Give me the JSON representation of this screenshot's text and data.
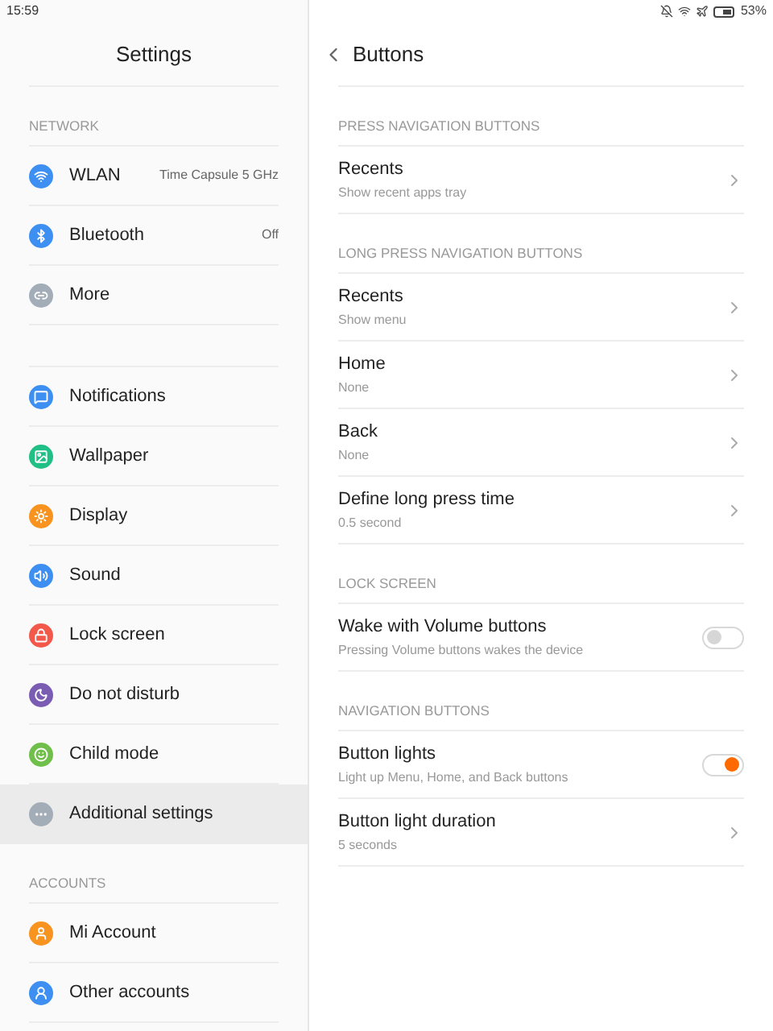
{
  "status_bar": {
    "time": "15:59",
    "battery": "53%"
  },
  "sidebar": {
    "title": "Settings",
    "groups": [
      {
        "header": "NETWORK",
        "items": [
          {
            "label": "WLAN",
            "value": "Time Capsule 5 GHz",
            "color": "#3d8ff2",
            "selected": false
          },
          {
            "label": "Bluetooth",
            "value": "Off",
            "color": "#3d8ff2",
            "selected": false
          },
          {
            "label": "More",
            "color": "#a3adb8",
            "selected": false
          }
        ]
      },
      {
        "items": [
          {
            "label": "Notifications",
            "color": "#3d8ff2",
            "selected": false
          },
          {
            "label": "Wallpaper",
            "color": "#1fbf86",
            "selected": false
          },
          {
            "label": "Display",
            "color": "#f7931e",
            "selected": false
          },
          {
            "label": "Sound",
            "color": "#3d8ff2",
            "selected": false
          },
          {
            "label": "Lock screen",
            "color": "#f2594b",
            "selected": false
          },
          {
            "label": "Do not disturb",
            "color": "#7b5cb3",
            "selected": false
          },
          {
            "label": "Child mode",
            "color": "#6fbf4a",
            "selected": false
          },
          {
            "label": "Additional settings",
            "color": "#a3adb8",
            "selected": true
          }
        ]
      },
      {
        "header": "ACCOUNTS",
        "items": [
          {
            "label": "Mi Account",
            "color": "#f7931e",
            "selected": false
          },
          {
            "label": "Other accounts",
            "color": "#3d8ff2",
            "selected": false
          }
        ]
      }
    ]
  },
  "page": {
    "title": "Buttons",
    "sections": [
      {
        "header": "PRESS NAVIGATION BUTTONS",
        "rows": [
          {
            "kind": "link",
            "title": "Recents",
            "subtitle": "Show recent apps tray"
          }
        ]
      },
      {
        "header": "LONG PRESS NAVIGATION BUTTONS",
        "rows": [
          {
            "kind": "link",
            "title": "Recents",
            "subtitle": "Show menu"
          },
          {
            "kind": "link",
            "title": "Home",
            "subtitle": "None"
          },
          {
            "kind": "link",
            "title": "Back",
            "subtitle": "None"
          },
          {
            "kind": "link",
            "title": "Define long press time",
            "subtitle": "0.5 second"
          }
        ]
      },
      {
        "header": "LOCK SCREEN",
        "rows": [
          {
            "kind": "toggle",
            "title": "Wake with Volume buttons",
            "subtitle": "Pressing Volume buttons wakes the device",
            "on": false
          }
        ]
      },
      {
        "header": "NAVIGATION BUTTONS",
        "rows": [
          {
            "kind": "toggle",
            "title": "Button lights",
            "subtitle": "Light up Menu, Home, and Back buttons",
            "on": true
          },
          {
            "kind": "link",
            "title": "Button light duration",
            "subtitle": "5 seconds"
          }
        ]
      }
    ]
  }
}
